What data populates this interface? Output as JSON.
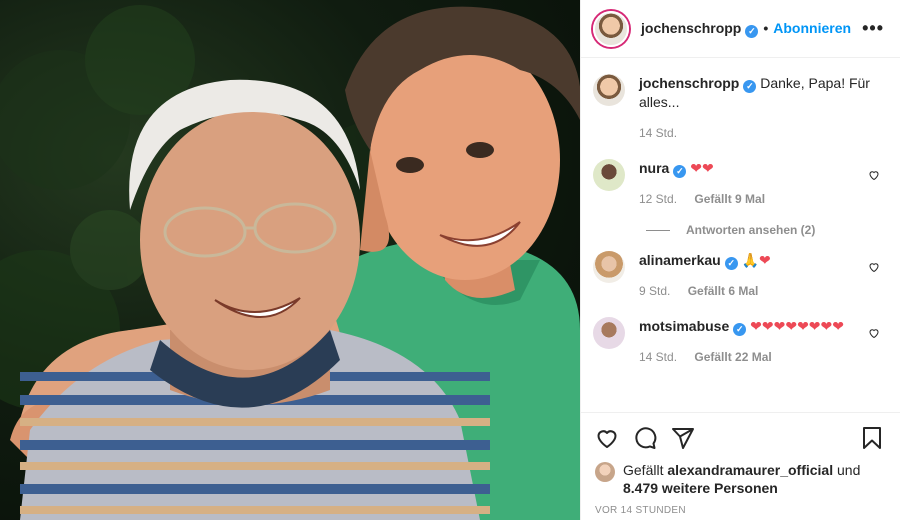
{
  "post": {
    "username": "jochenschropp",
    "follow_label": "Abonnieren",
    "more_label": "•••",
    "separator": "•"
  },
  "caption": {
    "username": "jochenschropp",
    "text": "Danke, Papa! Für alles...",
    "time": "14 Std."
  },
  "comments": [
    {
      "username": "nura",
      "text": "❤❤",
      "time": "12 Std.",
      "likes": "Gefällt 9 Mal"
    },
    {
      "username": "alinamerkau",
      "text": "🙏❤",
      "time": "9 Std.",
      "likes": "Gefällt 6 Mal"
    },
    {
      "username": "motsimabuse",
      "text": "❤❤❤❤❤❤❤❤",
      "time": "14 Std.",
      "likes": "Gefällt 22 Mal"
    }
  ],
  "replies_label": "Antworten ansehen (2)",
  "liked_by": {
    "prefix": "Gefällt ",
    "user": "alexandramaurer_official",
    "middle": " und",
    "count": "8.479 weitere Personen"
  },
  "timestamp": "VOR 14 STUNDEN",
  "colors": {
    "accent": "#0095f6",
    "verified": "#3897f0",
    "heart": "#ed4956",
    "muted": "#8e8e8e"
  },
  "icons": [
    "heart-icon",
    "comment-icon",
    "share-icon",
    "bookmark-icon",
    "verified-icon",
    "like-heart-icon"
  ]
}
